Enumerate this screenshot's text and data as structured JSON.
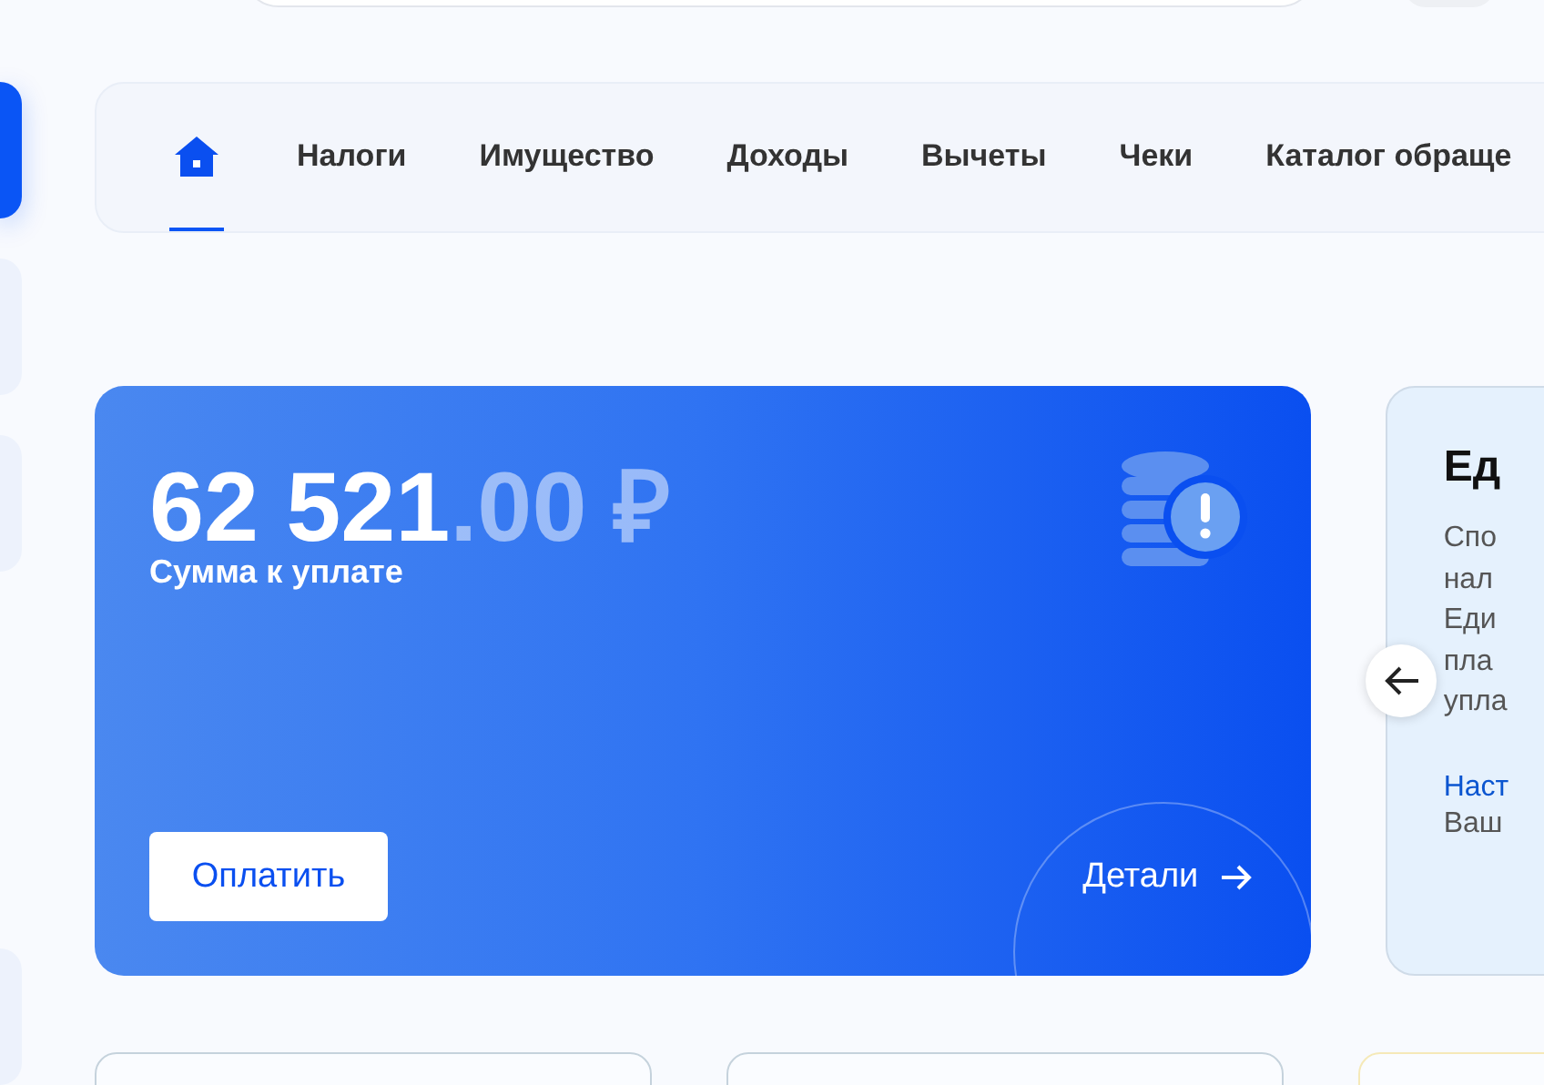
{
  "tabs": [
    {
      "kind": "home",
      "selected": true
    },
    {
      "kind": "text",
      "label": "Налоги",
      "selected": false
    },
    {
      "kind": "text",
      "label": "Имущество",
      "selected": false
    },
    {
      "kind": "text",
      "label": "Доходы",
      "selected": false
    },
    {
      "kind": "text",
      "label": "Вычеты",
      "selected": false
    },
    {
      "kind": "text",
      "label": "Чеки",
      "selected": false
    },
    {
      "kind": "text",
      "label": "Каталог обраще",
      "selected": false
    }
  ],
  "sidebar": {
    "items": [
      {
        "selected": true
      },
      {
        "selected": false
      },
      {
        "selected": false
      },
      {
        "selected": false
      }
    ]
  },
  "debt_card": {
    "amount": "62 521",
    "fraction": ".00 ₽",
    "caption": "Сумма к уплате",
    "pay_button": "Оплатить",
    "details_link": "Детали"
  },
  "info_card": {
    "title": "Ед",
    "description_lines": [
      "Спо",
      "нал",
      "Еди",
      "пла",
      "упла"
    ],
    "link": "Наст",
    "note": "Ваш"
  }
}
